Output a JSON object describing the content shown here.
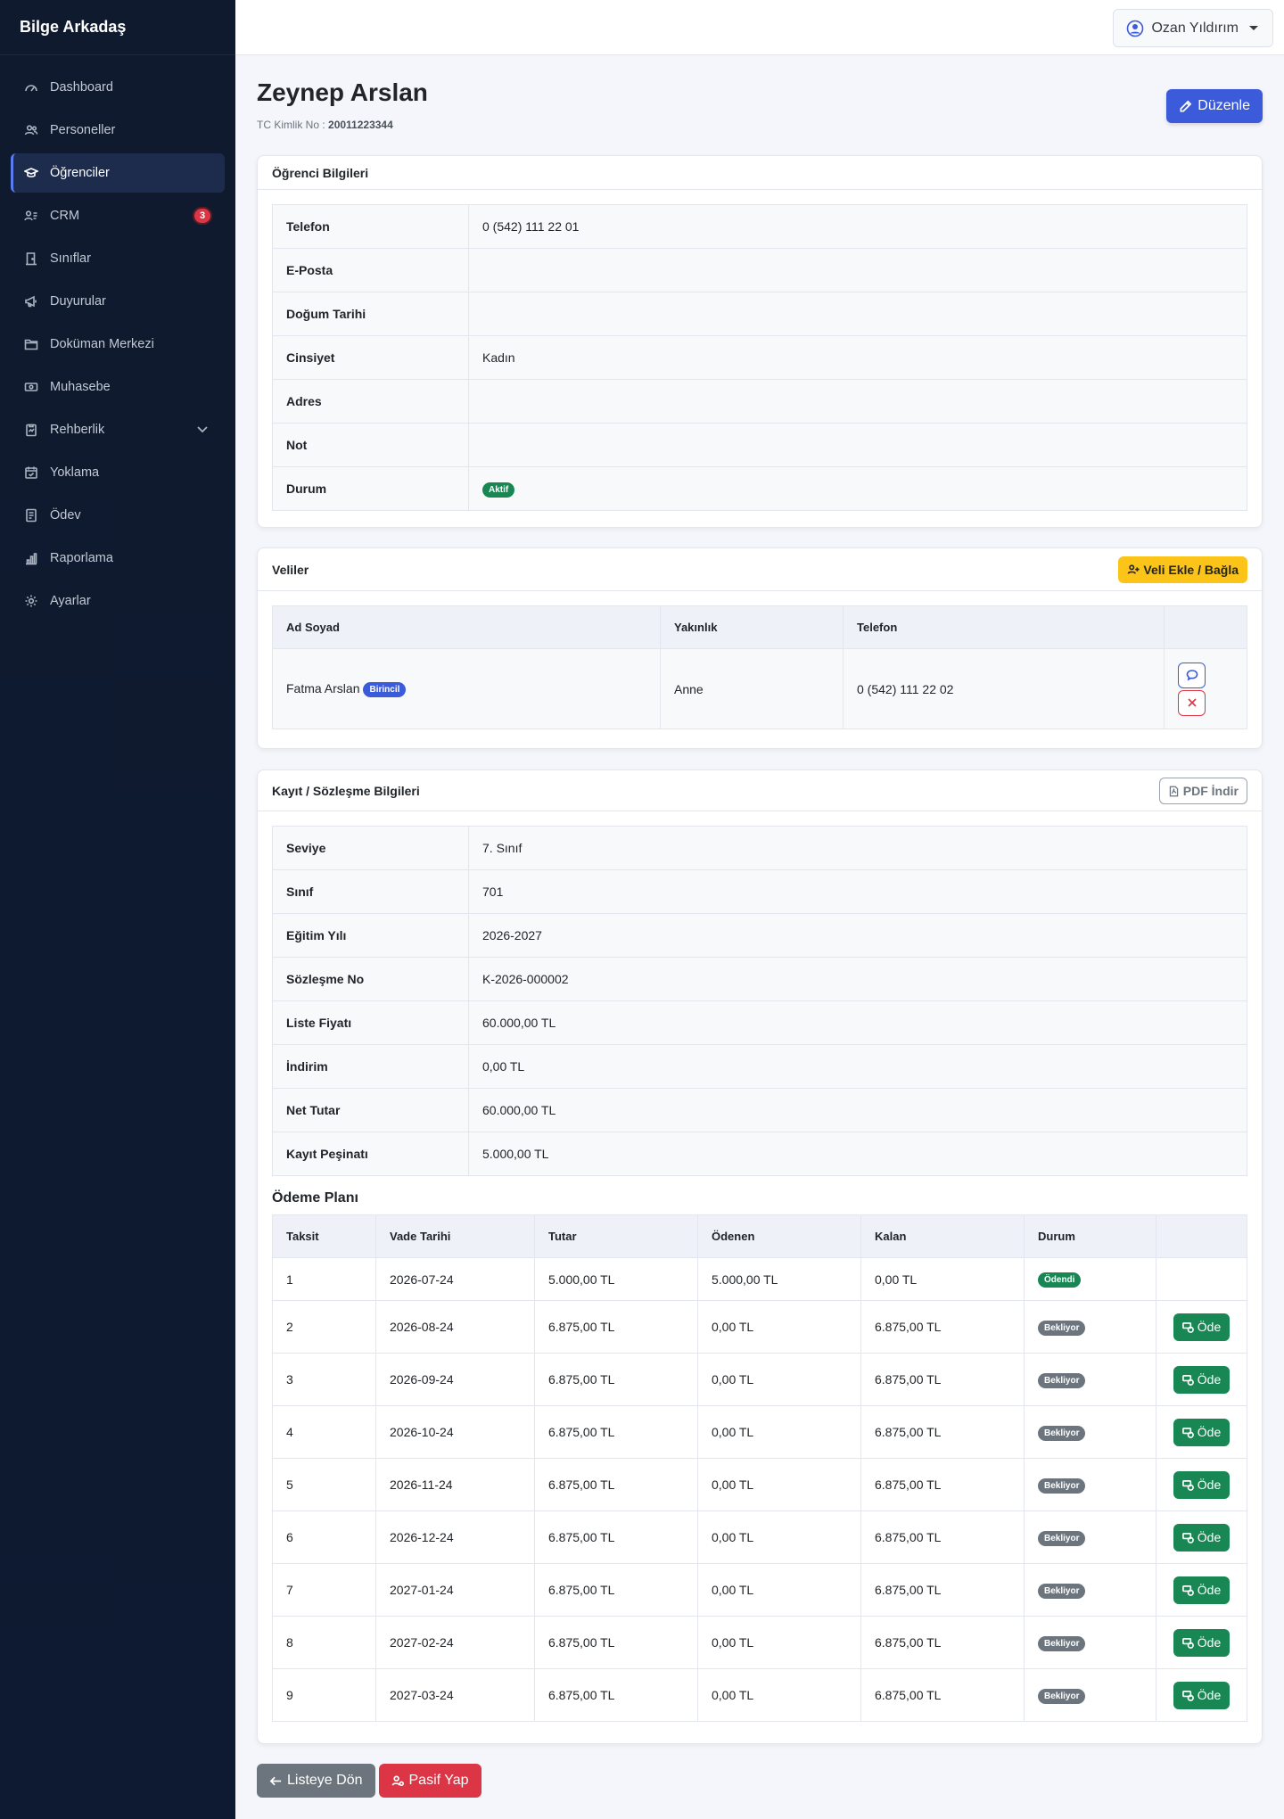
{
  "brand": "Bilge Arkadaş",
  "sidebar": {
    "items": [
      {
        "label": "Dashboard",
        "icon": "dashboard-icon"
      },
      {
        "label": "Personeller",
        "icon": "users-icon"
      },
      {
        "label": "Öğrenciler",
        "icon": "graduation-cap-icon",
        "active": true
      },
      {
        "label": "CRM",
        "icon": "contact-icon",
        "badge": "3"
      },
      {
        "label": "Sınıflar",
        "icon": "door-icon"
      },
      {
        "label": "Duyurular",
        "icon": "megaphone-icon"
      },
      {
        "label": "Doküman Merkezi",
        "icon": "folder-icon"
      },
      {
        "label": "Muhasebe",
        "icon": "cash-icon"
      },
      {
        "label": "Rehberlik",
        "icon": "clipboard-icon",
        "chevron": true
      },
      {
        "label": "Yoklama",
        "icon": "calendar-check-icon"
      },
      {
        "label": "Ödev",
        "icon": "journal-icon"
      },
      {
        "label": "Raporlama",
        "icon": "bar-chart-icon"
      },
      {
        "label": "Ayarlar",
        "icon": "gear-icon"
      }
    ]
  },
  "topbar": {
    "user_name": "Ozan Yıldırım"
  },
  "header": {
    "title": "Zeynep Arslan",
    "tc_label": "TC Kimlik No :",
    "tc_value": "20011223344",
    "edit_label": "Düzenle"
  },
  "student_info": {
    "title": "Öğrenci Bilgileri",
    "rows": [
      {
        "k": "Telefon",
        "v": "0 (542) 111 22 01"
      },
      {
        "k": "E-Posta",
        "v": ""
      },
      {
        "k": "Doğum Tarihi",
        "v": ""
      },
      {
        "k": "Cinsiyet",
        "v": "Kadın"
      },
      {
        "k": "Adres",
        "v": ""
      },
      {
        "k": "Not",
        "v": ""
      }
    ],
    "status_label": "Durum",
    "status_value": "Aktif"
  },
  "guardians": {
    "title": "Veliler",
    "add_label": "Veli Ekle / Bağla",
    "columns": [
      "Ad Soyad",
      "Yakınlık",
      "Telefon"
    ],
    "rows": [
      {
        "name": "Fatma Arslan",
        "tag": "Birincil",
        "relation": "Anne",
        "phone": "0 (542) 111 22 02"
      }
    ]
  },
  "contract": {
    "title": "Kayıt / Sözleşme Bilgileri",
    "pdf_label": "PDF İndir",
    "rows": [
      {
        "k": "Seviye",
        "v": "7. Sınıf"
      },
      {
        "k": "Sınıf",
        "v": "701"
      },
      {
        "k": "Eğitim Yılı",
        "v": "2026-2027"
      },
      {
        "k": "Sözleşme No",
        "v": "K-2026-000002"
      },
      {
        "k": "Liste Fiyatı",
        "v": "60.000,00 TL"
      },
      {
        "k": "İndirim",
        "v": "0,00 TL"
      },
      {
        "k": "Net Tutar",
        "v": "60.000,00 TL"
      },
      {
        "k": "Kayıt Peşinatı",
        "v": "5.000,00 TL"
      }
    ]
  },
  "plan": {
    "title": "Ödeme Planı",
    "columns": [
      "Taksit",
      "Vade Tarihi",
      "Tutar",
      "Ödenen",
      "Kalan",
      "Durum"
    ],
    "pay_label": "Öde",
    "rows": [
      {
        "no": "1",
        "date": "2026-07-24",
        "amount": "5.000,00 TL",
        "paid": "5.000,00 TL",
        "rest": "0,00 TL",
        "status": "Ödendi",
        "done": true
      },
      {
        "no": "2",
        "date": "2026-08-24",
        "amount": "6.875,00 TL",
        "paid": "0,00 TL",
        "rest": "6.875,00 TL",
        "status": "Bekliyor"
      },
      {
        "no": "3",
        "date": "2026-09-24",
        "amount": "6.875,00 TL",
        "paid": "0,00 TL",
        "rest": "6.875,00 TL",
        "status": "Bekliyor"
      },
      {
        "no": "4",
        "date": "2026-10-24",
        "amount": "6.875,00 TL",
        "paid": "0,00 TL",
        "rest": "6.875,00 TL",
        "status": "Bekliyor"
      },
      {
        "no": "5",
        "date": "2026-11-24",
        "amount": "6.875,00 TL",
        "paid": "0,00 TL",
        "rest": "6.875,00 TL",
        "status": "Bekliyor"
      },
      {
        "no": "6",
        "date": "2026-12-24",
        "amount": "6.875,00 TL",
        "paid": "0,00 TL",
        "rest": "6.875,00 TL",
        "status": "Bekliyor"
      },
      {
        "no": "7",
        "date": "2027-01-24",
        "amount": "6.875,00 TL",
        "paid": "0,00 TL",
        "rest": "6.875,00 TL",
        "status": "Bekliyor"
      },
      {
        "no": "8",
        "date": "2027-02-24",
        "amount": "6.875,00 TL",
        "paid": "0,00 TL",
        "rest": "6.875,00 TL",
        "status": "Bekliyor"
      },
      {
        "no": "9",
        "date": "2027-03-24",
        "amount": "6.875,00 TL",
        "paid": "0,00 TL",
        "rest": "6.875,00 TL",
        "status": "Bekliyor"
      }
    ]
  },
  "footer": {
    "back_label": "Listeye Dön",
    "deactivate_label": "Pasif Yap"
  },
  "colors": {
    "primary": "#3b5bdb",
    "success": "#198754",
    "danger": "#dc3545",
    "warning": "#fcc419",
    "sidebar": "#0f1a2e"
  }
}
